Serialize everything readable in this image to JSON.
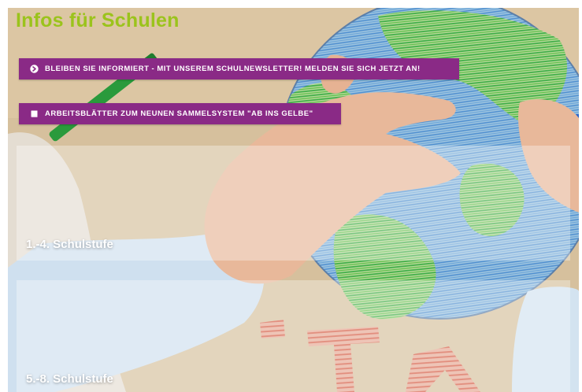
{
  "page": {
    "title": "Infos für Schulen"
  },
  "actions": [
    {
      "label": "BLEIBEN SIE INFORMIERT - MIT UNSEREM SCHULNEWSLETTER! MELDEN SIE SICH JETZT AN!",
      "icon": "arrow-circle-right-icon"
    },
    {
      "label": "ARBEITSBLÄTTER ZUM NEUNEN SAMMELSYSTEM \"AB INS GELBE\"",
      "icon": "book-icon"
    }
  ],
  "grades": [
    {
      "label": "1.-4. Schulstufe"
    },
    {
      "label": "5.-8. Schulstufe"
    }
  ],
  "colors": {
    "title": "#9bc31c",
    "button_bg": "#8a2a86",
    "button_text": "#ffffff",
    "panel_overlay": "rgba(255,255,255,0.33)"
  }
}
